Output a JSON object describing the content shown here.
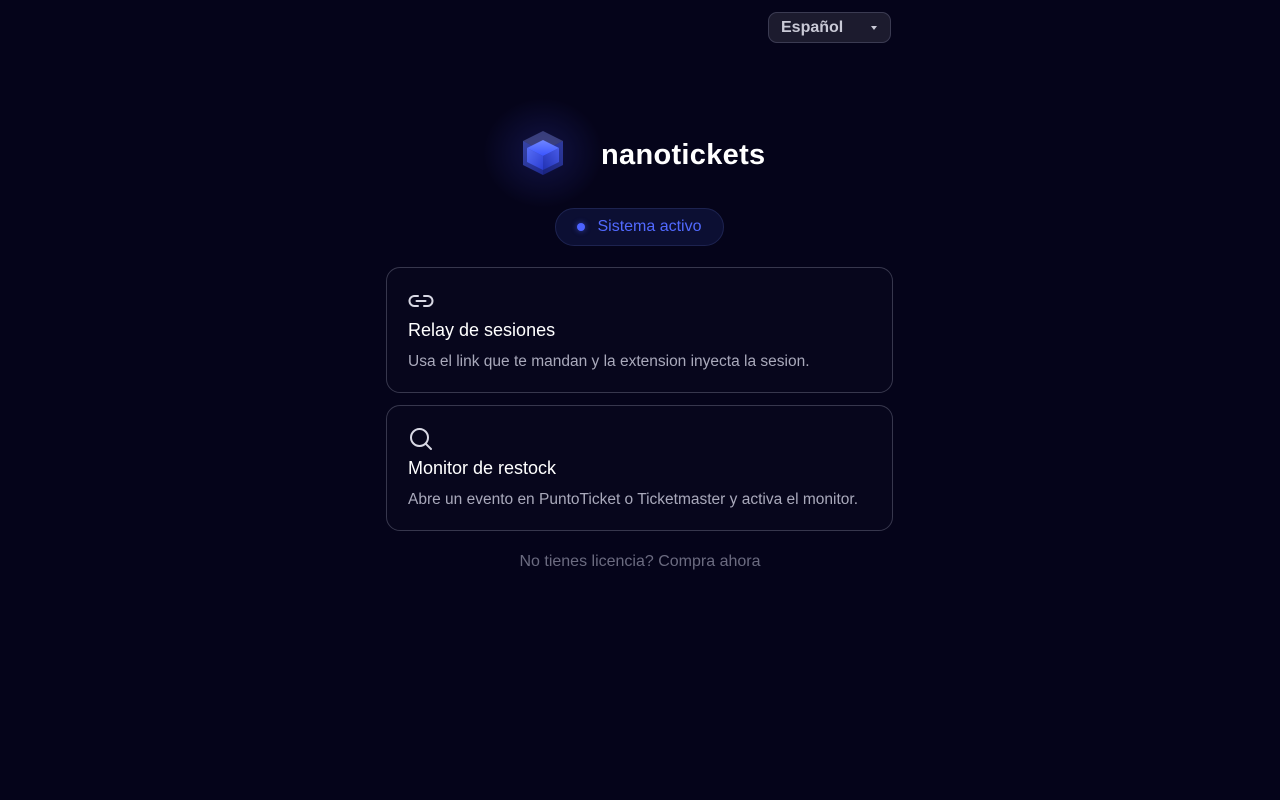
{
  "language_select": {
    "selected": "Español",
    "icon": "chevron-down-icon"
  },
  "brand": {
    "name": "nanotickets",
    "logo_icon": "cube-logo-icon",
    "accent_color": "#4d63ff"
  },
  "status": {
    "label": "Sistema activo",
    "color": "#5169ff"
  },
  "features": [
    {
      "icon": "link-icon",
      "title": "Relay de sesiones",
      "description": "Usa el link que te mandan y la extension inyecta la sesion."
    },
    {
      "icon": "search-icon",
      "title": "Monitor de restock",
      "description": "Abre un evento en PuntoTicket o Ticketmaster y activa el monitor."
    }
  ],
  "footer": {
    "license_text": "No tienes licencia? Compra ahora"
  }
}
